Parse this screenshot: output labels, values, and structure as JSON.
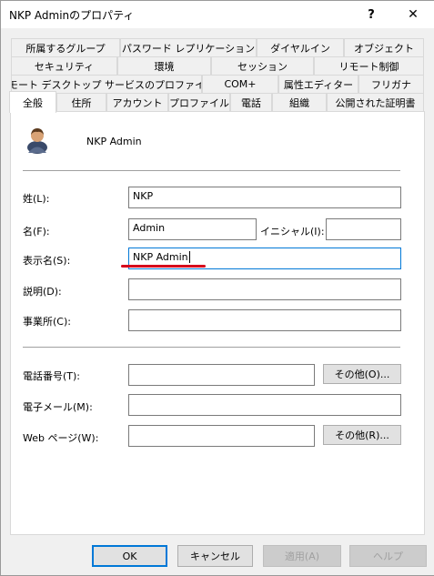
{
  "window": {
    "title": "NKP Adminのプロパティ",
    "help_glyph": "?",
    "close_glyph": "✕"
  },
  "tabs": {
    "row1": [
      "所属するグループ",
      "パスワード レプリケーション",
      "ダイヤルイン",
      "オブジェクト"
    ],
    "row2": [
      "セキュリティ",
      "環境",
      "セッション",
      "リモート制御"
    ],
    "row3": [
      "リモート デスクトップ サービスのプロファイル",
      "COM+",
      "属性エディター",
      "フリガナ"
    ],
    "row4": [
      "全般",
      "住所",
      "アカウント",
      "プロファイル",
      "電話",
      "組織",
      "公開された証明書"
    ]
  },
  "general": {
    "display_header": "NKP Admin",
    "last_name_label": "姓(L):",
    "last_name_value": "NKP",
    "first_name_label": "名(F):",
    "first_name_value": "Admin",
    "initials_label": "イニシャル(I):",
    "initials_value": "",
    "display_name_label": "表示名(S):",
    "display_name_value": "NKP Admin",
    "description_label": "説明(D):",
    "description_value": "",
    "office_label": "事業所(C):",
    "office_value": "",
    "phone_label": "電話番号(T):",
    "phone_value": "",
    "other_phone_button": "その他(O)...",
    "email_label": "電子メール(M):",
    "email_value": "",
    "web_label": "Web ページ(W):",
    "web_value": "",
    "other_web_button": "その他(R)..."
  },
  "footer": {
    "ok": "OK",
    "cancel": "キャンセル",
    "apply": "適用(A)",
    "help": "ヘルプ"
  },
  "colors": {
    "annotation": "#d6001c",
    "accent": "#0078d7"
  }
}
